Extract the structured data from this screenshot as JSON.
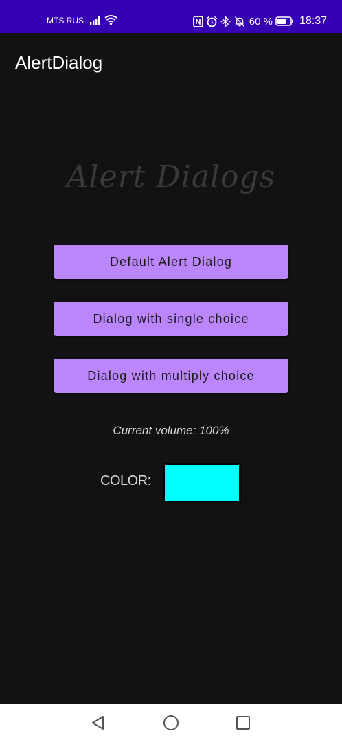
{
  "status_bar": {
    "carrier": "MTS RUS",
    "battery_percent": "60 %",
    "time": "18:37",
    "icons": [
      "signal-icon",
      "wifi-icon",
      "nfc-icon",
      "alarm-icon",
      "bluetooth-icon",
      "mute-icon",
      "battery-icon"
    ]
  },
  "app_bar": {
    "title": "AlertDialog"
  },
  "main": {
    "hero_title": "Alert Dialogs",
    "buttons": [
      {
        "label": "Default Alert Dialog"
      },
      {
        "label": "Dialog with single choice"
      },
      {
        "label": "Dialog with multiply choice"
      }
    ],
    "volume_text": "Current volume: 100%",
    "color_label": "COLOR:",
    "color_value": "#00ffff"
  },
  "nav_bar": {
    "icons": [
      "back-icon",
      "home-icon",
      "recent-apps-icon"
    ]
  },
  "colors": {
    "status_bar": "#3700b3",
    "background": "#121212",
    "button": "#bb86fc"
  }
}
